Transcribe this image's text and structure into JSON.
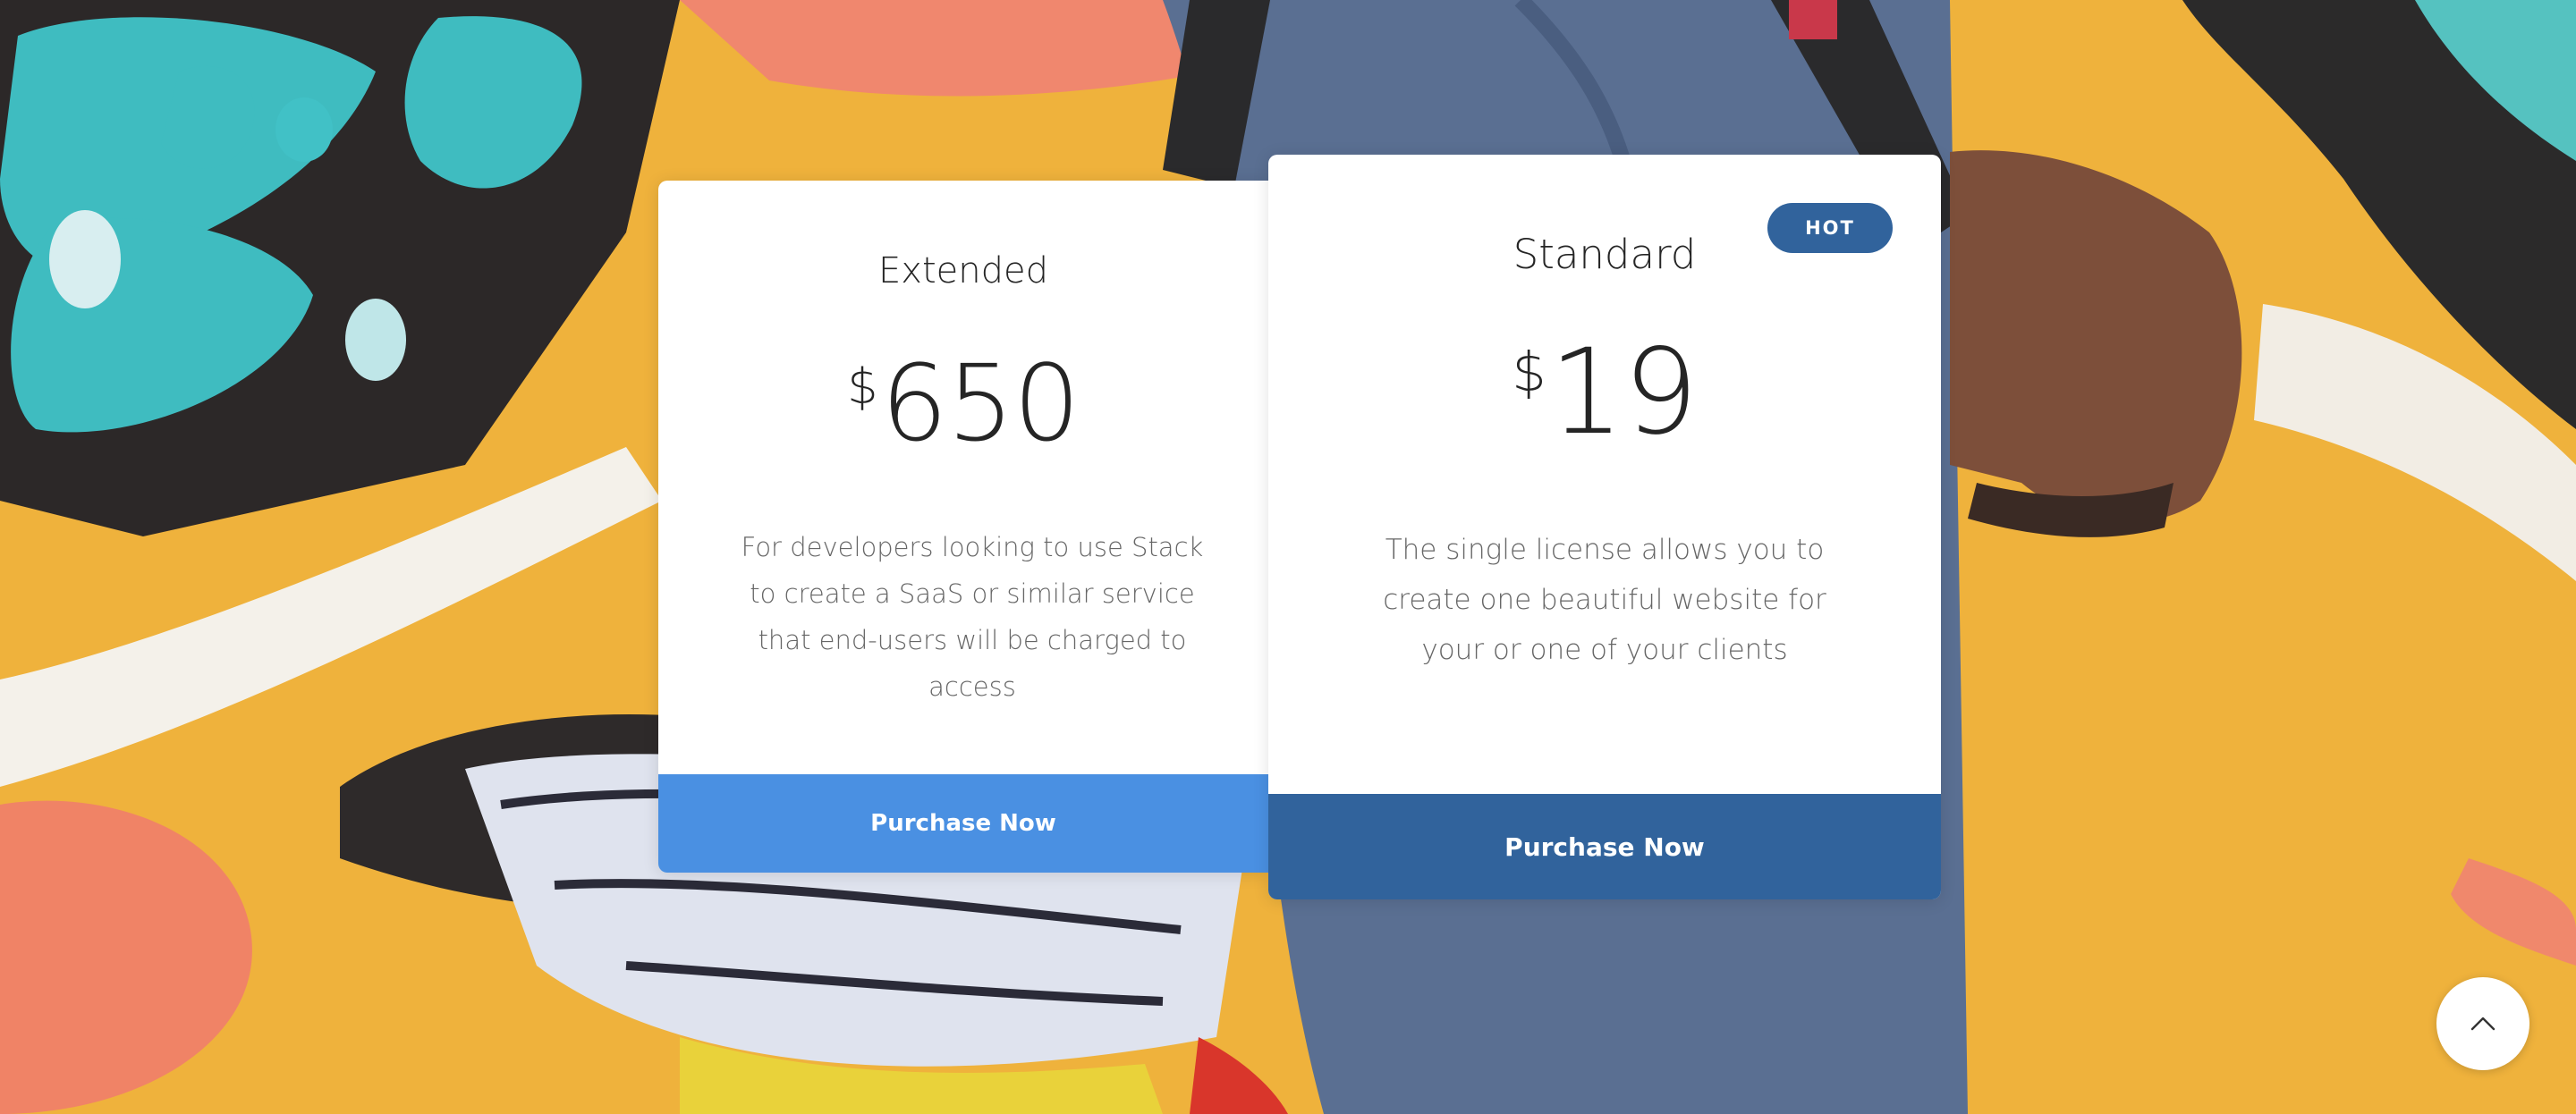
{
  "plans": [
    {
      "name": "Extended",
      "currency": "$",
      "amount": "650",
      "description": "For developers looking to use Stack to create a SaaS or similar service that end-users will be charged to access",
      "cta": "Purchase Now"
    },
    {
      "name": "Standard",
      "currency": "$",
      "amount": "19",
      "description": "The single license allows you to create one beautiful website for your or one of your clients",
      "cta": "Purchase Now",
      "badge": "HOT"
    }
  ],
  "colors": {
    "accent": "#4a90e2",
    "accent_dark": "#31639c",
    "heading": "#252525",
    "body_text": "#666666"
  },
  "icons": {
    "back_to_top": "chevron-up-icon"
  }
}
